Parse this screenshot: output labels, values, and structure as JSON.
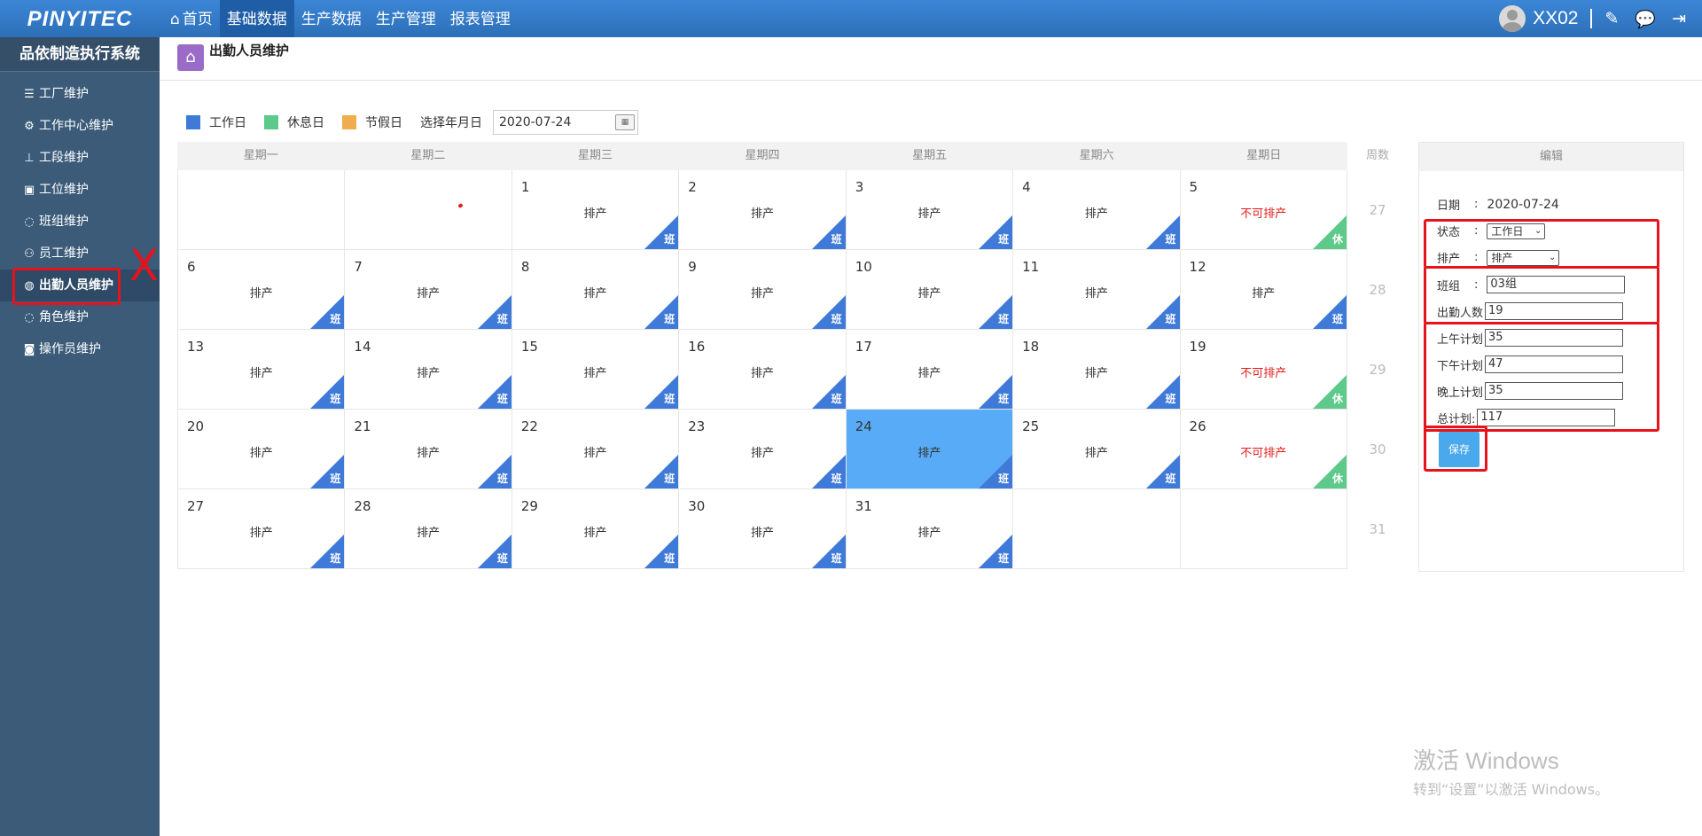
{
  "brand": {
    "logo_text": "PINYITEC",
    "logo_small": ""
  },
  "topnav": {
    "items": [
      {
        "label": "首页",
        "active": false
      },
      {
        "label": "基础数据",
        "active": true
      },
      {
        "label": "生产数据",
        "active": false
      },
      {
        "label": "生产管理",
        "active": false
      },
      {
        "label": "报表管理",
        "active": false
      }
    ],
    "username": "XX02"
  },
  "sidebar": {
    "system_title": "品依制造执行系统",
    "items": [
      {
        "label": "工厂维护",
        "icon": "list-icon"
      },
      {
        "label": "工作中心维护",
        "icon": "network-icon"
      },
      {
        "label": "工段维护",
        "icon": "hierarchy-icon"
      },
      {
        "label": "工位维护",
        "icon": "workstation-icon"
      },
      {
        "label": "班组维护",
        "icon": "chat-icon"
      },
      {
        "label": "员工维护",
        "icon": "people-icon"
      },
      {
        "label": "出勤人员维护",
        "icon": "globe-icon",
        "active": true
      },
      {
        "label": "角色维护",
        "icon": "chat-icon"
      },
      {
        "label": "操作员维护",
        "icon": "camera-icon"
      }
    ]
  },
  "page": {
    "title": "出勤人员维护"
  },
  "legend": {
    "items": [
      {
        "label": "工作日",
        "color": "#3f7ad8"
      },
      {
        "label": "休息日",
        "color": "#5dc98b"
      },
      {
        "label": "节假日",
        "color": "#f0ad4e"
      }
    ],
    "select_label": "选择年月日",
    "date_value": "2020-07-24"
  },
  "calendar": {
    "weekdays": [
      "星期一",
      "星期二",
      "星期三",
      "星期四",
      "星期五",
      "星期六",
      "星期日"
    ],
    "week_header": "周数",
    "week_numbers": [
      "27",
      "28",
      "29",
      "30",
      "31"
    ],
    "weeks": [
      [
        {
          "day": "",
          "status": "",
          "tag": ""
        },
        {
          "day": "",
          "status": "",
          "tag": ""
        },
        {
          "day": "1",
          "status": "排产",
          "tag": "班"
        },
        {
          "day": "2",
          "status": "排产",
          "tag": "班"
        },
        {
          "day": "3",
          "status": "排产",
          "tag": "班"
        },
        {
          "day": "4",
          "status": "排产",
          "tag": "班"
        },
        {
          "day": "5",
          "status": "不可排产",
          "tag": "休"
        }
      ],
      [
        {
          "day": "6",
          "status": "排产",
          "tag": "班"
        },
        {
          "day": "7",
          "status": "排产",
          "tag": "班"
        },
        {
          "day": "8",
          "status": "排产",
          "tag": "班"
        },
        {
          "day": "9",
          "status": "排产",
          "tag": "班"
        },
        {
          "day": "10",
          "status": "排产",
          "tag": "班"
        },
        {
          "day": "11",
          "status": "排产",
          "tag": "班"
        },
        {
          "day": "12",
          "status": "排产",
          "tag": "班"
        }
      ],
      [
        {
          "day": "13",
          "status": "排产",
          "tag": "班"
        },
        {
          "day": "14",
          "status": "排产",
          "tag": "班"
        },
        {
          "day": "15",
          "status": "排产",
          "tag": "班"
        },
        {
          "day": "16",
          "status": "排产",
          "tag": "班"
        },
        {
          "day": "17",
          "status": "排产",
          "tag": "班"
        },
        {
          "day": "18",
          "status": "排产",
          "tag": "班"
        },
        {
          "day": "19",
          "status": "不可排产",
          "tag": "休"
        }
      ],
      [
        {
          "day": "20",
          "status": "排产",
          "tag": "班"
        },
        {
          "day": "21",
          "status": "排产",
          "tag": "班"
        },
        {
          "day": "22",
          "status": "排产",
          "tag": "班"
        },
        {
          "day": "23",
          "status": "排产",
          "tag": "班"
        },
        {
          "day": "24",
          "status": "排产",
          "tag": "班",
          "selected": true
        },
        {
          "day": "25",
          "status": "排产",
          "tag": "班"
        },
        {
          "day": "26",
          "status": "不可排产",
          "tag": "休"
        }
      ],
      [
        {
          "day": "27",
          "status": "排产",
          "tag": "班"
        },
        {
          "day": "28",
          "status": "排产",
          "tag": "班"
        },
        {
          "day": "29",
          "status": "排产",
          "tag": "班"
        },
        {
          "day": "30",
          "status": "排产",
          "tag": "班"
        },
        {
          "day": "31",
          "status": "排产",
          "tag": "班"
        },
        {
          "day": "",
          "status": "",
          "tag": ""
        },
        {
          "day": "",
          "status": "",
          "tag": ""
        }
      ]
    ]
  },
  "edit": {
    "header": "编辑",
    "date_label": "日期",
    "date_value": "2020-07-24",
    "state_label": "状态",
    "state_value": "工作日",
    "schedule_label": "排产",
    "schedule_value": "排产",
    "team_label": "班组",
    "team_value": "03组",
    "attend_label": "出勤人数",
    "attend_value": "19",
    "am_label": "上午计划",
    "am_value": "35",
    "pm_label": "下午计划",
    "pm_value": "47",
    "night_label": "晚上计划",
    "night_value": "35",
    "total_label": "总计划:",
    "total_value": "117",
    "save_label": "保存"
  },
  "watermark": {
    "line1": "激活 Windows",
    "line2": "转到“设置”以激活 Windows。"
  },
  "annotation": {
    "mark": "X"
  }
}
